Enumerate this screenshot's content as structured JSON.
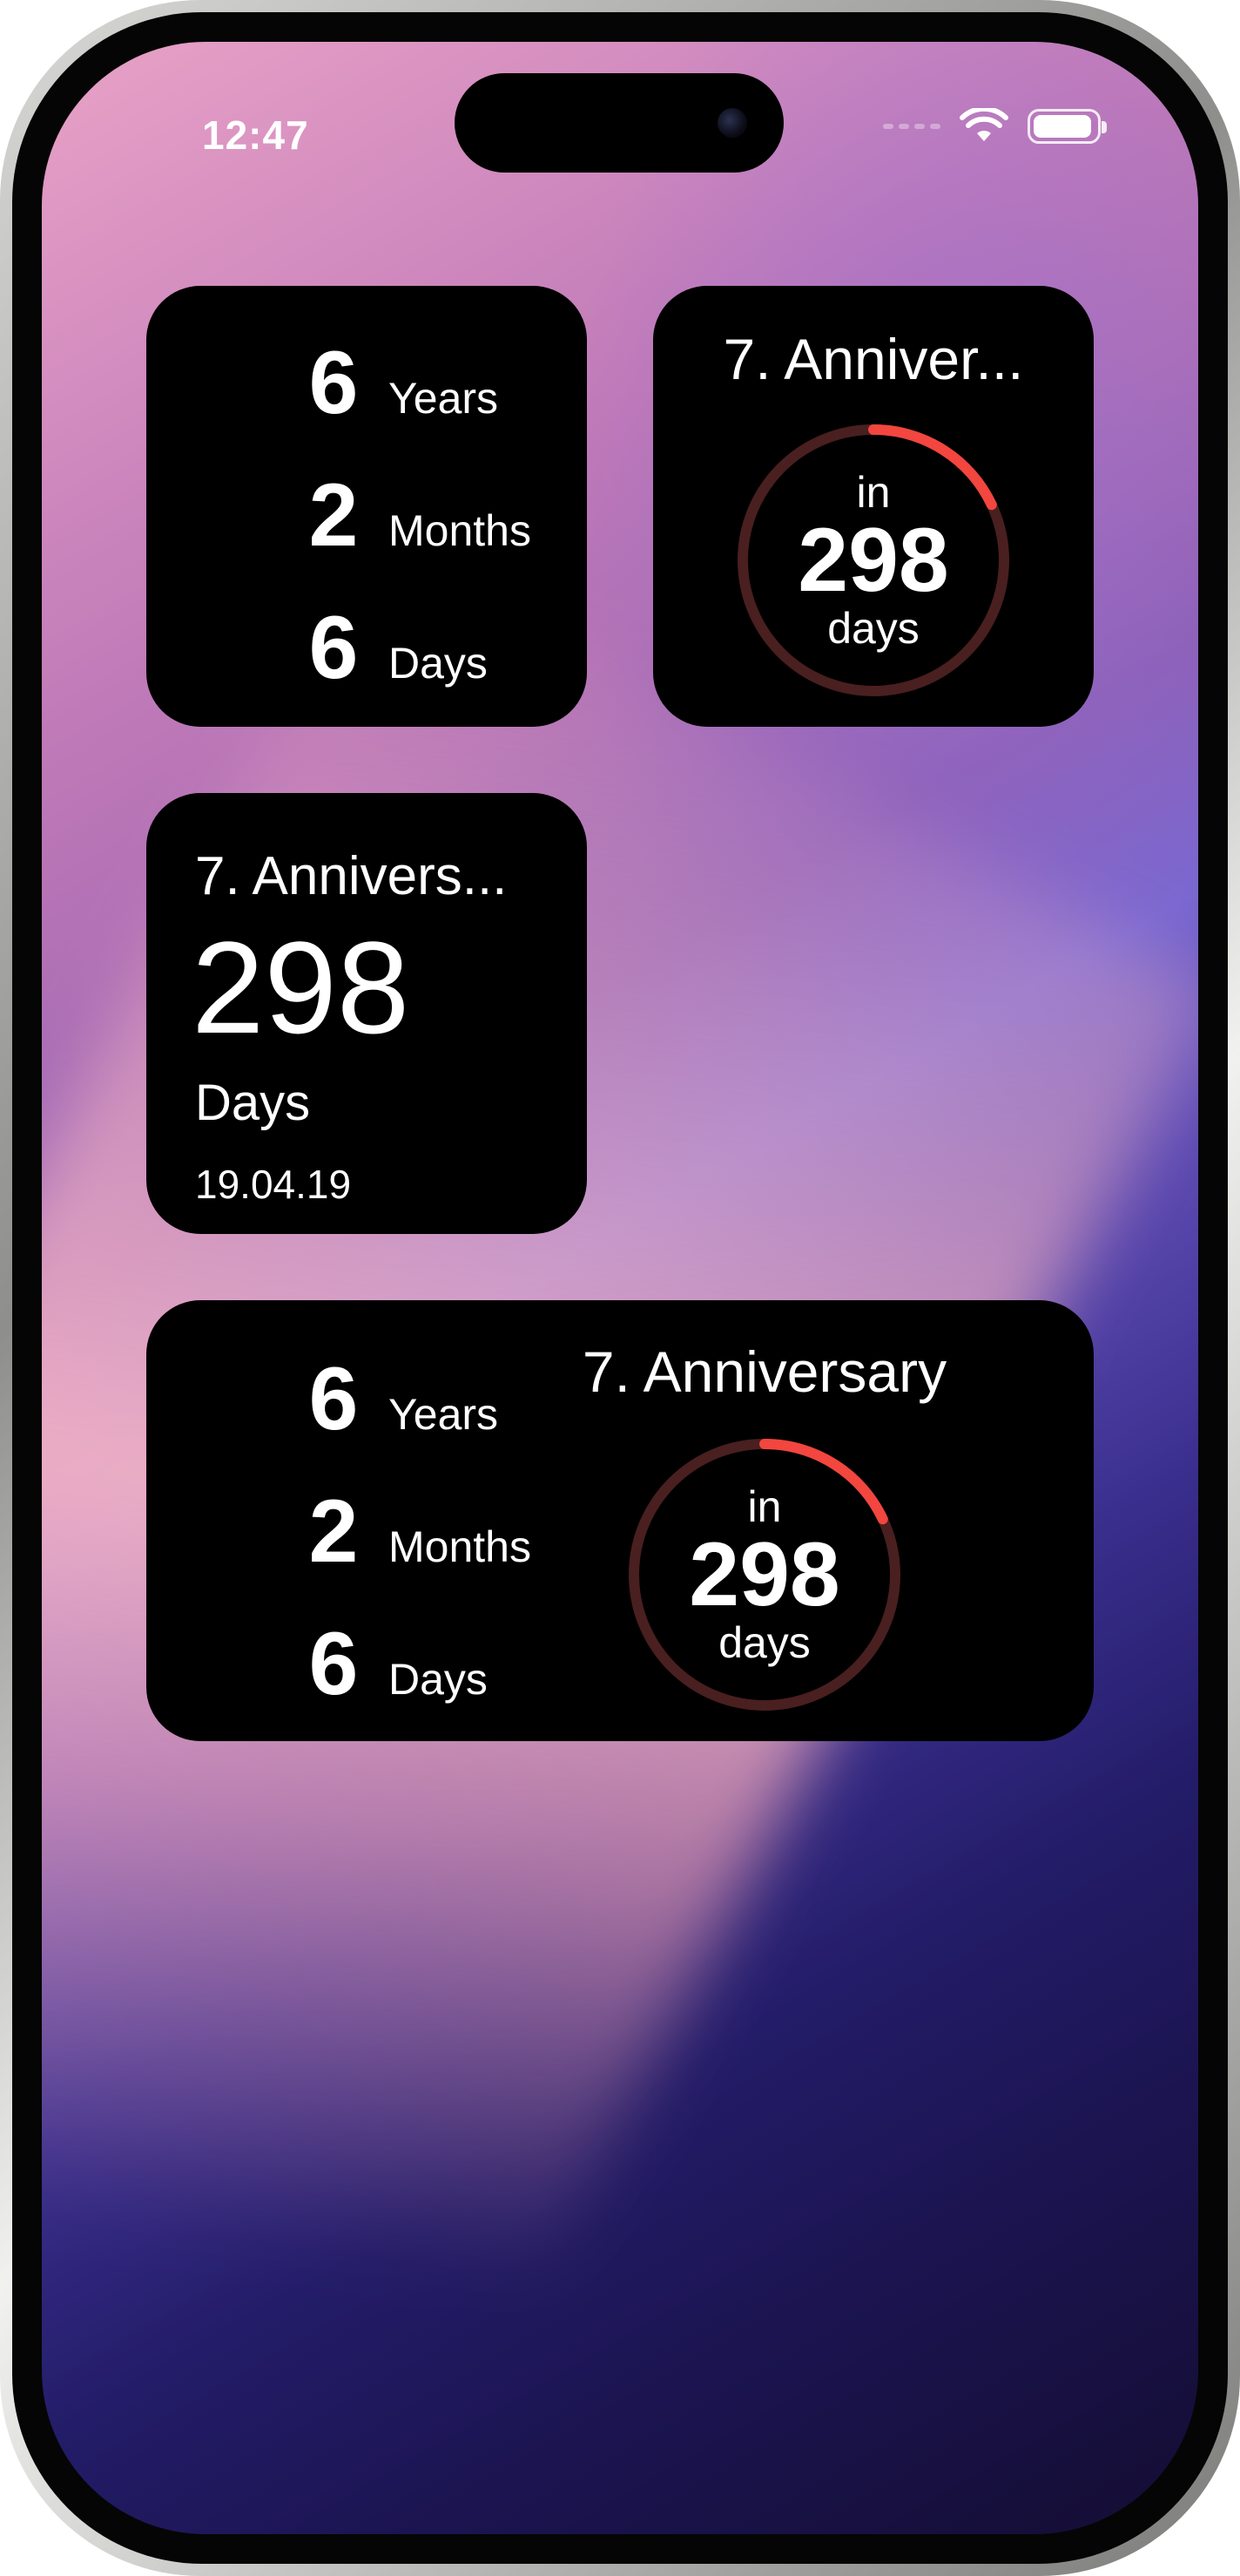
{
  "status_bar": {
    "time": "12:47"
  },
  "widgets": {
    "duration_small": {
      "rows": [
        {
          "value": "6",
          "unit": "Years"
        },
        {
          "value": "2",
          "unit": "Months"
        },
        {
          "value": "6",
          "unit": "Days"
        }
      ]
    },
    "ring_small": {
      "title": "7. Anniver...",
      "prefix": "in",
      "value": "298",
      "unit": "days",
      "progress": 0.18
    },
    "text_small": {
      "title": "7.  Annivers...",
      "value": "298",
      "unit": "Days",
      "date": "19.04.19"
    },
    "medium": {
      "rows": [
        {
          "value": "6",
          "unit": "Years"
        },
        {
          "value": "2",
          "unit": "Months"
        },
        {
          "value": "6",
          "unit": "Days"
        }
      ],
      "title": "7. Anniversary",
      "prefix": "in",
      "value": "298",
      "unit": "days",
      "progress": 0.18
    }
  },
  "colors": {
    "ring_track": "#4a1f1f",
    "ring_progress": "#f2463f",
    "widget_bg": "#000000"
  }
}
